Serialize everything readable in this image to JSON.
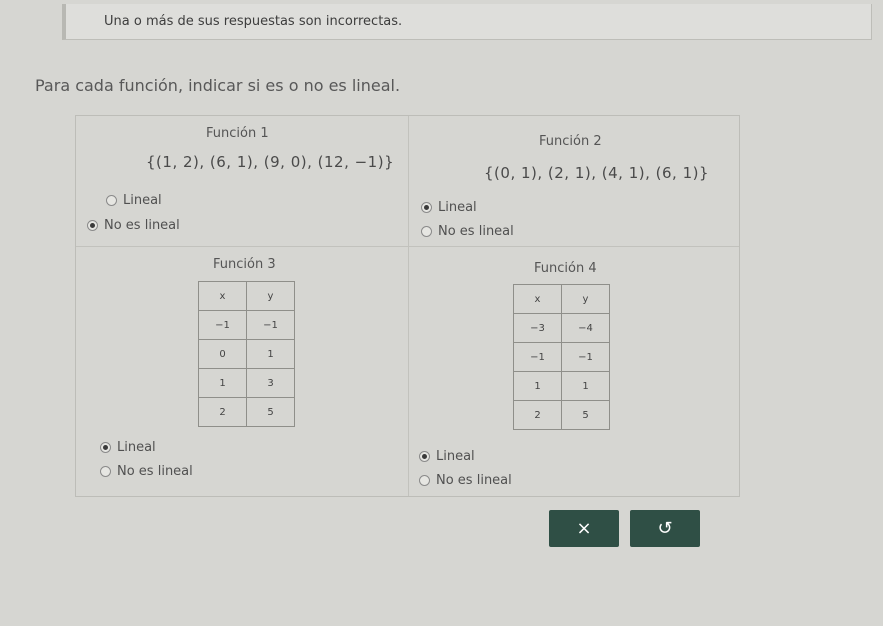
{
  "feedback": {
    "message": "Una o más de sus respuestas son incorrectas."
  },
  "instruction": "Para cada función, indicar si es o no es lineal.",
  "functions": [
    {
      "title": "Función 1",
      "set": "{(1, 2), (6, 1), (9, 0), (12, −1)}",
      "options": [
        {
          "label": "Lineal",
          "selected": false
        },
        {
          "label": "No es lineal",
          "selected": true
        }
      ]
    },
    {
      "title": "Función 2",
      "set": "{(0, 1), (2, 1), (4, 1), (6, 1)}",
      "options": [
        {
          "label": "Lineal",
          "selected": true
        },
        {
          "label": "No es lineal",
          "selected": false
        }
      ]
    },
    {
      "title": "Función 3",
      "table": {
        "headers": [
          "x",
          "y"
        ],
        "rows": [
          [
            "−1",
            "−1"
          ],
          [
            "0",
            "1"
          ],
          [
            "1",
            "3"
          ],
          [
            "2",
            "5"
          ]
        ]
      },
      "options": [
        {
          "label": "Lineal",
          "selected": true
        },
        {
          "label": "No es lineal",
          "selected": false
        }
      ]
    },
    {
      "title": "Función 4",
      "table": {
        "headers": [
          "x",
          "y"
        ],
        "rows": [
          [
            "−3",
            "−4"
          ],
          [
            "−1",
            "−1"
          ],
          [
            "1",
            "1"
          ],
          [
            "2",
            "5"
          ]
        ]
      },
      "options": [
        {
          "label": "Lineal",
          "selected": true
        },
        {
          "label": "No es lineal",
          "selected": false
        }
      ]
    }
  ],
  "buttons": {
    "clear_icon": "×",
    "undo_icon": "↺"
  }
}
